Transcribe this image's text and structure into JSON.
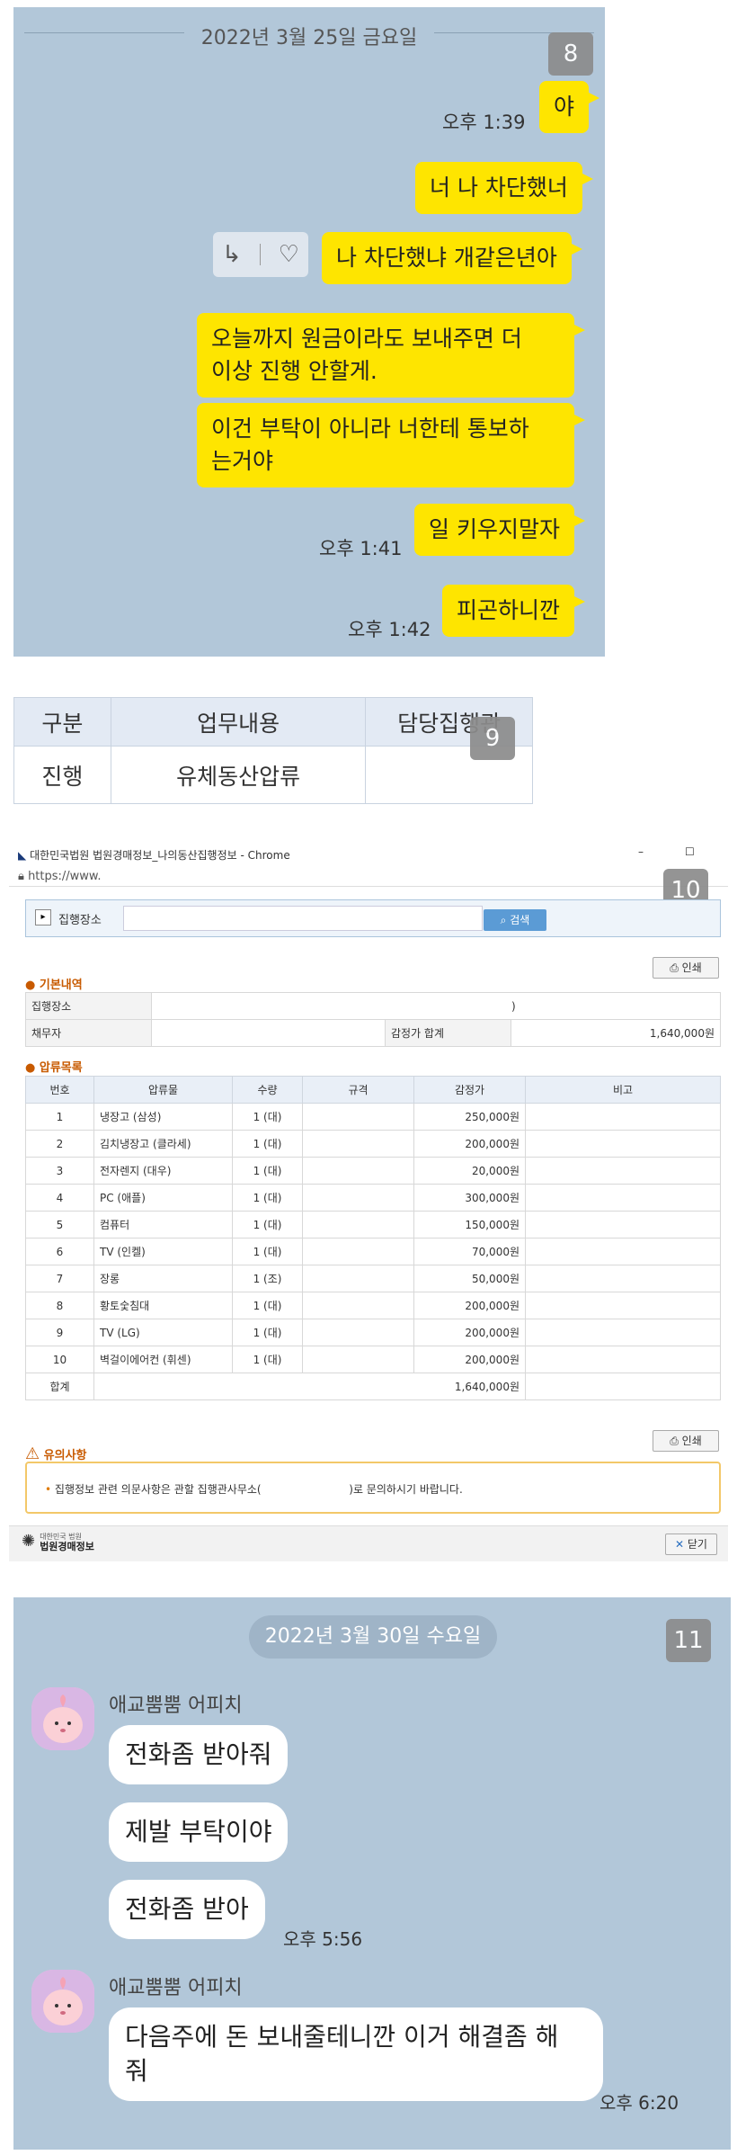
{
  "panel8": {
    "badge": "8",
    "date": "2022년 3월 25일 금요일",
    "messages": [
      {
        "text": "야",
        "time": "오후 1:39"
      },
      {
        "text": "너 나 차단했너",
        "time": ""
      },
      {
        "text": "나 차단했냐 개같은년아",
        "time": ""
      },
      {
        "line1": "오늘까지 원금이라도 보내주면 더",
        "line2": "이상 진행 안할게.",
        "time": ""
      },
      {
        "line1": "이건 부탁이 아니라 너한테 통보하",
        "line2": "는거야",
        "time": ""
      },
      {
        "text": "일 키우지말자",
        "time": "오후 1:41"
      },
      {
        "text": "피곤하니깐",
        "time": "오후 1:42"
      }
    ],
    "reaction_icons": [
      "reply-icon",
      "heart-icon"
    ]
  },
  "panel9": {
    "badge": "9",
    "headers": [
      "구분",
      "업무내용",
      "담당집행관"
    ],
    "row": [
      "진행",
      "유체동산압류",
      ""
    ]
  },
  "panel10": {
    "badge": "10",
    "window_title": "대한민국법원 법원경매정보_나의동산집행정보 - Chrome",
    "url": "https://www.",
    "search_label": "집행장소",
    "search_button": "검색",
    "print_label": "인쇄",
    "basic_section": "기본내역",
    "basic": {
      "place_label": "집행장소",
      "place_value": ")",
      "debtor_label": "채무자",
      "total_label": "감정가 합계",
      "total_value": "1,640,000원"
    },
    "seize_section": "압류목록",
    "columns": [
      "번호",
      "압류물",
      "수량",
      "규격",
      "감정가",
      "비고"
    ],
    "rows": [
      [
        "1",
        "냉장고 (삼성)",
        "1 (대)",
        "",
        "250,000원",
        ""
      ],
      [
        "2",
        "김치냉장고 (클라세)",
        "1 (대)",
        "",
        "200,000원",
        ""
      ],
      [
        "3",
        "전자렌지 (대우)",
        "1 (대)",
        "",
        "20,000원",
        ""
      ],
      [
        "4",
        "PC (애플)",
        "1 (대)",
        "",
        "300,000원",
        ""
      ],
      [
        "5",
        "컴퓨터",
        "1 (대)",
        "",
        "150,000원",
        ""
      ],
      [
        "6",
        "TV (인켈)",
        "1 (대)",
        "",
        "70,000원",
        ""
      ],
      [
        "7",
        "장롱",
        "1 (조)",
        "",
        "50,000원",
        ""
      ],
      [
        "8",
        "황토숯침대",
        "1 (대)",
        "",
        "200,000원",
        ""
      ],
      [
        "9",
        "TV (LG)",
        "1 (대)",
        "",
        "200,000원",
        ""
      ],
      [
        "10",
        "벽걸이에어컨 (휘센)",
        "1 (대)",
        "",
        "200,000원",
        ""
      ]
    ],
    "total_row_label": "합계",
    "total_row_value": "1,640,000원",
    "notice_title": "유의사항",
    "notice_text_a": "집행정보 관련 의문사항은 관할 집행관사무소(",
    "notice_text_b": ")로 문의하시기 바랍니다.",
    "footer_logo_small": "대한민국 법원",
    "footer_logo_big": "법원경매정보",
    "close_label": "닫기"
  },
  "panel11": {
    "badge": "11",
    "date": "2022년 3월 30일 수요일",
    "sender": "애교뿜뿜 어피치",
    "group1": [
      {
        "text": "전화좀 받아줘"
      },
      {
        "text": "제발 부탁이야"
      },
      {
        "text": "전화좀 받아",
        "time": "오후 5:56"
      }
    ],
    "group2": {
      "line1": "다음주에 돈 보내줄테니깐 이거 해결좀 해",
      "line2": "줘",
      "time": "오후 6:20"
    }
  }
}
